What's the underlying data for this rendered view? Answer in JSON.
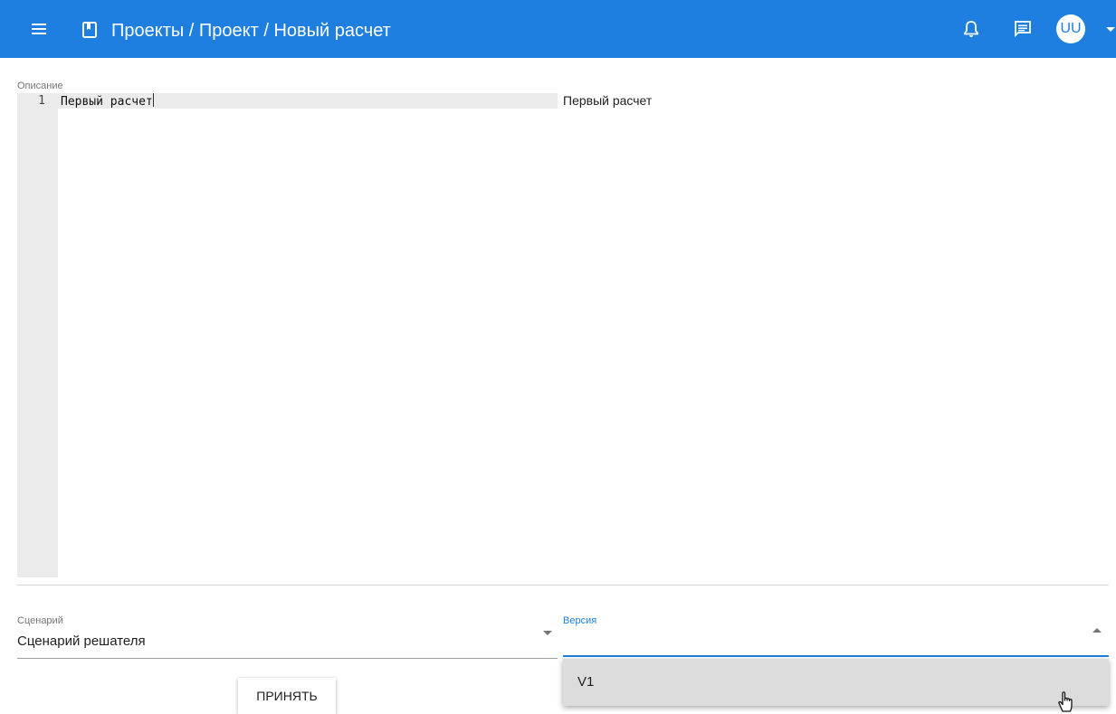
{
  "header": {
    "title": "Проекты / Проект / Новый расчет",
    "avatar_initials": "UU",
    "icons": {
      "menu": "hamburger-menu-icon",
      "project": "book-icon",
      "notifications": "bell-icon",
      "messages": "chat-icon",
      "account_menu": "caret-down-icon"
    }
  },
  "description": {
    "label": "Описание",
    "editor": {
      "line_number": "1",
      "text": "Первый расчет"
    },
    "preview": "Первый расчет"
  },
  "scenario": {
    "label": "Сценарий",
    "value": "Сценарий решателя"
  },
  "version": {
    "label": "Версия",
    "value": "",
    "options": [
      "V1"
    ]
  },
  "actions": {
    "accept_label": "ПРИНЯТЬ"
  },
  "colors": {
    "primary": "#1e7fe0",
    "editor_gutter": "#ebebeb",
    "dropdown_bg": "#dcdcdc"
  }
}
